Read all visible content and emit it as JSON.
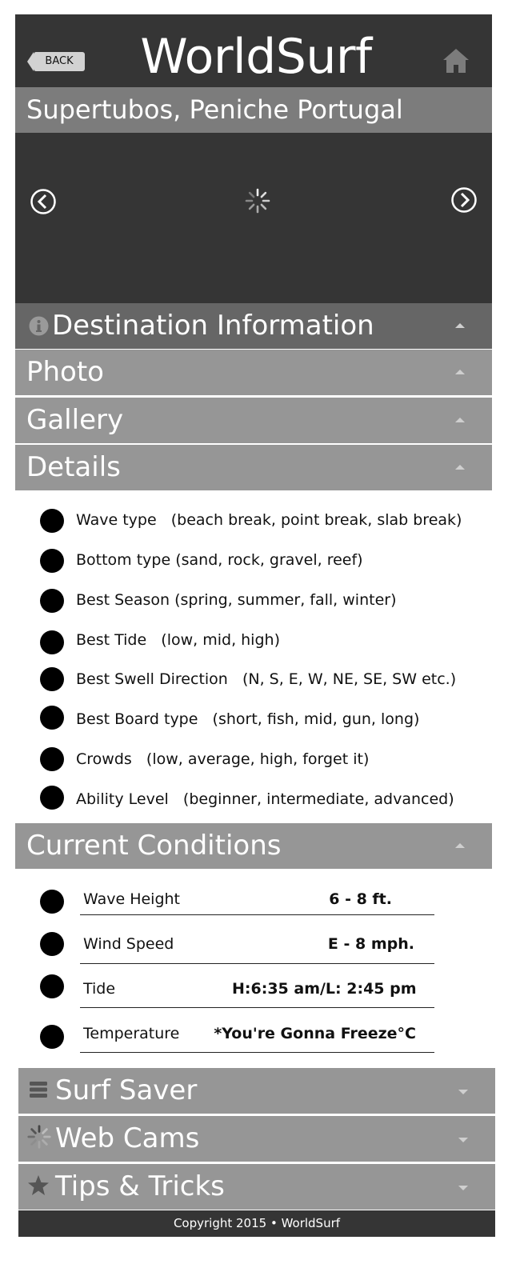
{
  "header": {
    "back_label": "BACK",
    "brand": "WorldSurf",
    "home_icon": "home-icon"
  },
  "destination": {
    "title": "Supertubos, Peniche Portugal"
  },
  "slider": {
    "prev_icon": "chevron-left-circle-icon",
    "next_icon": "chevron-right-circle-icon",
    "loading_icon": "spinner-icon"
  },
  "sections": {
    "destination_info": "Destination Information",
    "photo": "Photo",
    "gallery": "Gallery",
    "details": "Details",
    "current_conditions": "Current Conditions",
    "surf_saver": "Surf Saver",
    "web_cams": "Web Cams",
    "tips_tricks": "Tips & Tricks"
  },
  "details": [
    "Wave type   (beach break, point break, slab break)",
    "Bottom type (sand, rock, gravel, reef)",
    "Best Season (spring, summer, fall, winter)",
    "Best Tide   (low, mid, high)",
    "Best Swell Direction   (N, S, E, W, NE, SE, SW etc.)",
    "Best Board type   (short, fish, mid, gun, long)",
    "Crowds   (low, average, high, forget it)",
    "Ability Level   (beginner, intermediate, advanced)"
  ],
  "conditions": [
    {
      "label": "Wave Height",
      "value": "6 - 8 ft."
    },
    {
      "label": "Wind Speed",
      "value": "E - 8 mph."
    },
    {
      "label": "Tide",
      "value": "H:6:35 am/L: 2:45 pm"
    },
    {
      "label": "Temperature",
      "value": "*You're Gonna Freeze°C"
    }
  ],
  "footer": {
    "copyright": "Copyright 2015 • WorldSurf"
  },
  "colors": {
    "header_bg": "#353535",
    "title_bar_bg": "#7c7c7c",
    "section_bar_bg": "#969696",
    "dest_info_bg": "#666666"
  }
}
